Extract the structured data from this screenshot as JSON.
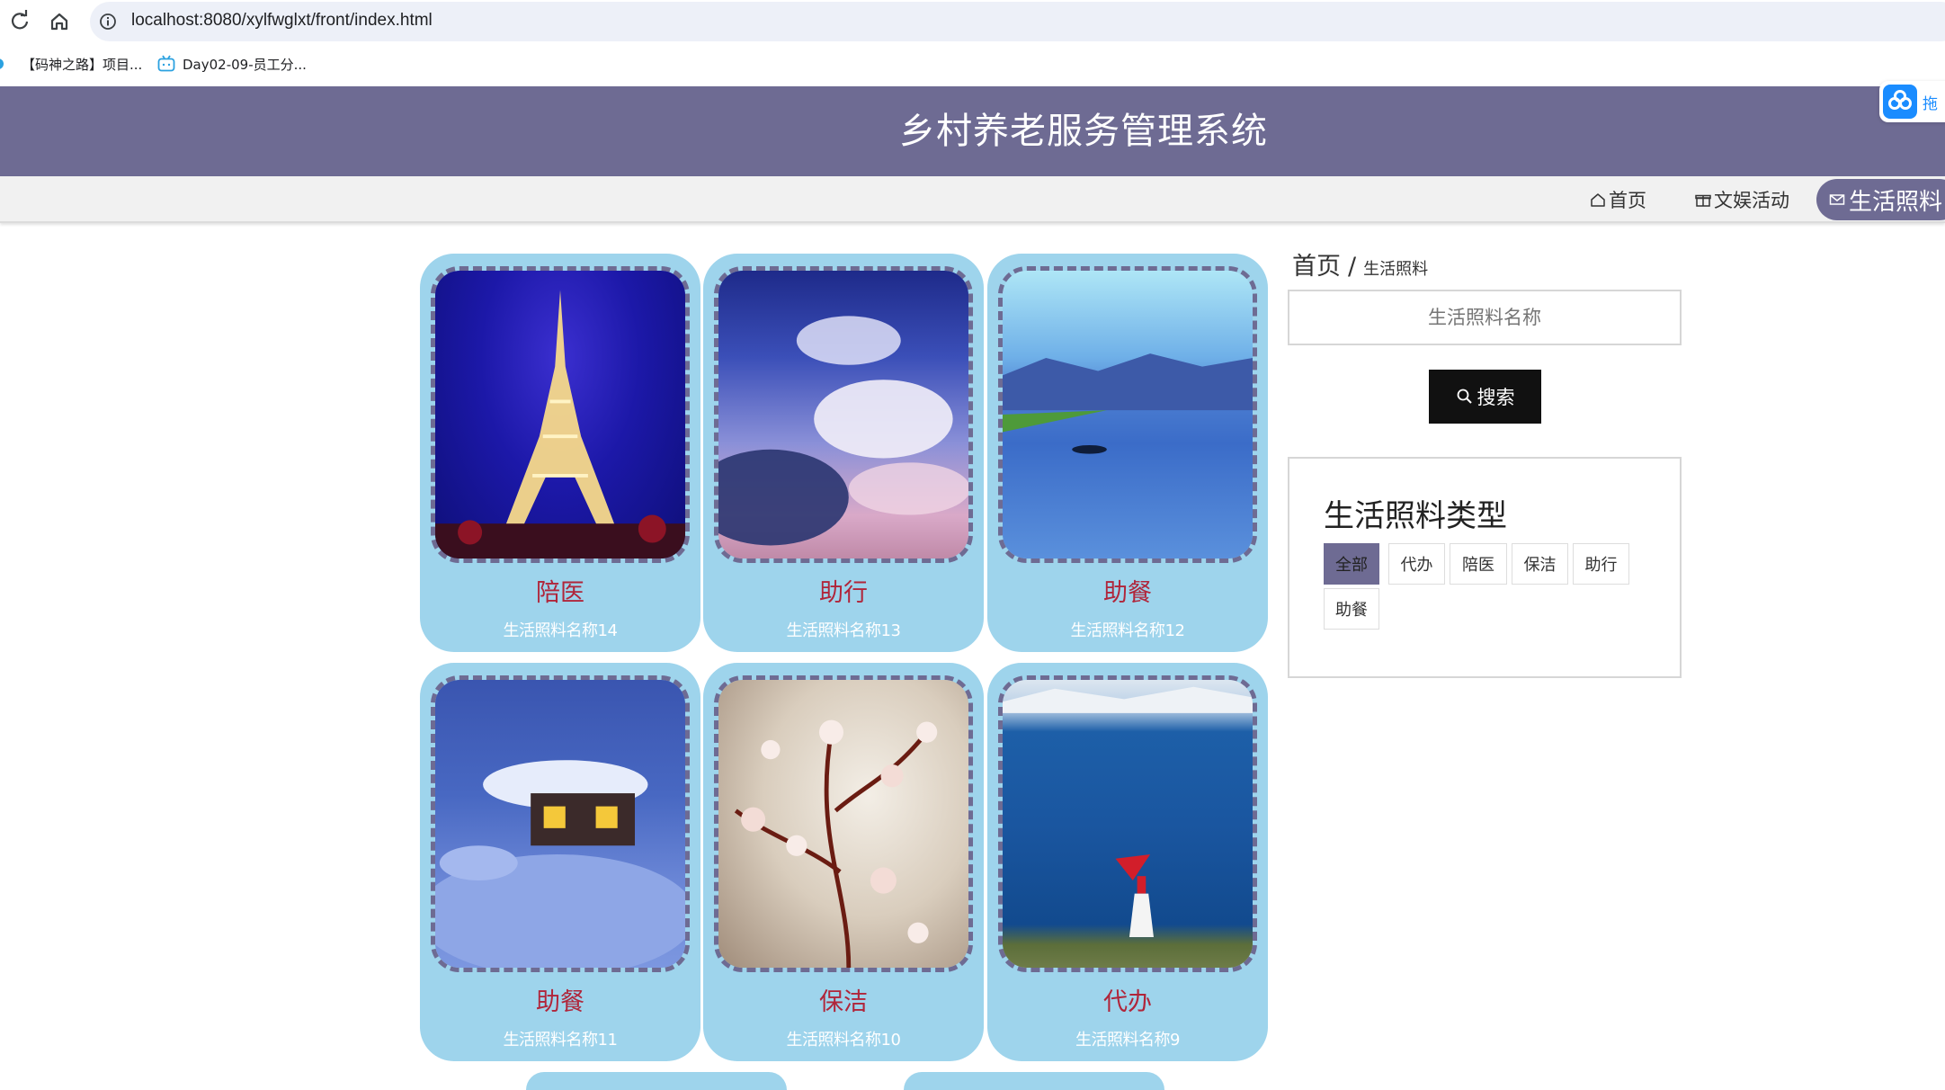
{
  "browser": {
    "url": "localhost:8080/xylfwglxt/front/index.html",
    "bookmarks": [
      {
        "label": "【码神之路】项目..."
      },
      {
        "label": "Day02-09-员工分..."
      }
    ]
  },
  "header": {
    "title": "乡村养老服务管理系统",
    "float_widget_label": "拖"
  },
  "nav": {
    "items": [
      {
        "label": "首页",
        "icon": "home-icon"
      },
      {
        "label": "文娱活动",
        "icon": "gift-icon"
      },
      {
        "label": "生活照料",
        "icon": "mail-icon",
        "active": true
      }
    ]
  },
  "cards": [
    {
      "type": "陪医",
      "name": "生活照料名称14",
      "image": "eiffel-tower-night"
    },
    {
      "type": "助行",
      "name": "生活照料名称13",
      "image": "clouds-sky"
    },
    {
      "type": "助餐",
      "name": "生活照料名称12",
      "image": "lake-boat"
    },
    {
      "type": "助餐",
      "name": "生活照料名称11",
      "image": "snow-cabin"
    },
    {
      "type": "保洁",
      "name": "生活照料名称10",
      "image": "cherry-blossom"
    },
    {
      "type": "代办",
      "name": "生活照料名称9",
      "image": "blue-lake-woman"
    }
  ],
  "breadcrumb": {
    "home": "首页",
    "separator": "/",
    "current": "生活照料"
  },
  "search": {
    "placeholder": "生活照料名称",
    "button_label": "搜索"
  },
  "types_panel": {
    "title": "生活照料类型",
    "tags": [
      {
        "label": "全部",
        "active": true
      },
      {
        "label": "代办"
      },
      {
        "label": "陪医"
      },
      {
        "label": "保洁"
      },
      {
        "label": "助行"
      },
      {
        "label": "助餐"
      }
    ]
  },
  "colors": {
    "header_bg": "#6e6b93",
    "card_bg": "#9ed4ec",
    "card_type_text": "#b0253a",
    "search_button_bg": "#111111"
  }
}
